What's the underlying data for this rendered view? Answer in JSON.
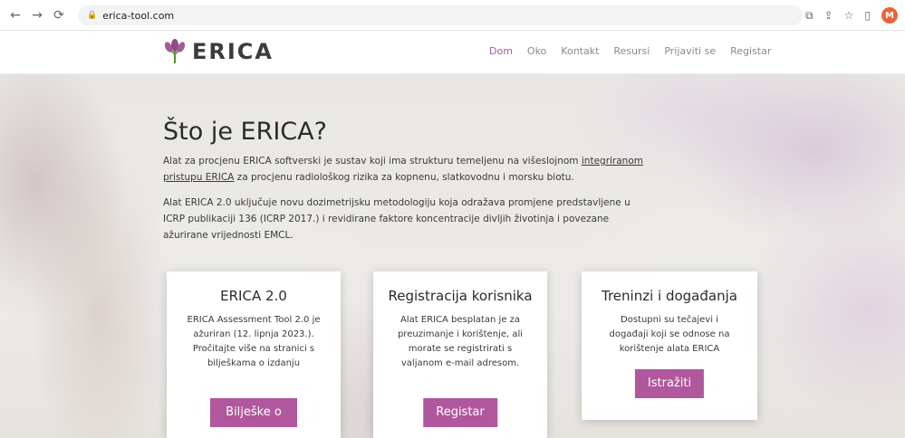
{
  "browser": {
    "url": "erica-tool.com",
    "profile_initial": "M"
  },
  "site": {
    "logo_text": "ERICA",
    "nav": [
      {
        "label": "Dom",
        "active": true
      },
      {
        "label": "Oko"
      },
      {
        "label": "Kontakt"
      },
      {
        "label": "Resursi"
      },
      {
        "label": "Prijaviti se"
      },
      {
        "label": "Registar"
      }
    ],
    "accent_color": "#b0569b"
  },
  "hero": {
    "title": "Što je ERICA?",
    "p1_a": "Alat za procjenu ERICA softverski je sustav koji ima strukturu temeljenu na višeslojnom ",
    "p1_link1": "integriranom",
    "p1_link2": "pristupu ERICA",
    "p1_b": " za procjenu radiološkog rizika za kopnenu, slatkovodnu i morsku biotu.",
    "p2": "Alat ERICA 2.0 uključuje novu dozimetrijsku metodologiju koja odražava promjene predstavljene u ICRP publikaciji 136 (ICRP 2017.) i revidirane faktore koncentracije divljih životinja i povezane ažurirane vrijednosti EMCL."
  },
  "cards": [
    {
      "title": "ERICA 2.0",
      "text": "ERICA Assessment Tool 2.0 je ažuriran (12. lipnja 2023.). Pročitajte više na stranici s bilješkama o izdanju",
      "button": "Bilješke o izdanju"
    },
    {
      "title": "Registracija korisnika",
      "text": "Alat ERICA besplatan je za preuzimanje i korištenje, ali morate se registrirati s valjanom e-mail adresom.",
      "button": "Registar"
    },
    {
      "title": "Treninzi i događanja",
      "text": "Dostupni su tečajevi i događaji koji se odnose na korištenje alata ERICA",
      "button": "Istražiti"
    }
  ]
}
